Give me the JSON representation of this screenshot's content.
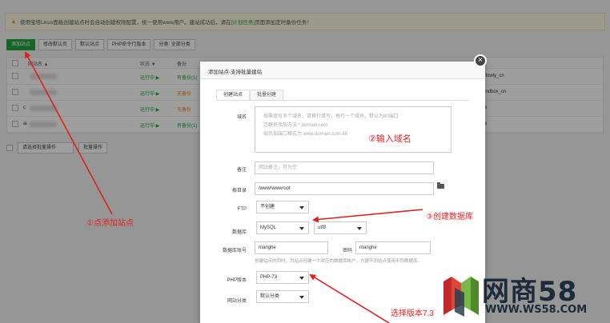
{
  "notice": {
    "text": "使用宝塔Linux面板创建站点时会自动创建权限配置，统一使用www用户。建站成功后，请在",
    "link": "[计划任务]",
    "suffix": "页面添加定时备份任务！"
  },
  "toolbar": {
    "add_site": "添加站点",
    "modify_default_page": "修改默认页",
    "default_site": "默认站点",
    "php_cli_version": "PHP命令行版本",
    "category": "分类: 全部分类"
  },
  "table": {
    "headers": {
      "site_name": "网站名 ▲",
      "status": "状态 ▼",
      "backup": "备份"
    },
    "rows": [
      {
        "prefix": "",
        "status": "运行中 ▶",
        "backup": "有备份(1)",
        "remark": "flowly_cn"
      },
      {
        "prefix": "",
        "status": "运行中 ▶",
        "backup": "无备份",
        "remark": "indbox_cn"
      },
      {
        "prefix": "c",
        "status": "运行中 ▶",
        "backup": "无备份",
        "remark": "e"
      },
      {
        "prefix": "ai",
        "status": "运行中 ▶",
        "backup": "有备份(1)",
        "remark": "e"
      }
    ],
    "batch_select": "请选择批量操作",
    "batch_button": "批量操作"
  },
  "modal": {
    "title": "添加站点-支持批量建站",
    "close": "×",
    "tabs": [
      "创建站点",
      "批量创建"
    ],
    "domain": {
      "label": "域名",
      "placeholder_lines": [
        "如需填写多个域名，请换行填写，每行一个域名，默认为80端口",
        "泛解析添加方法 *.domain.com",
        "如另加端口格式为 www.domain.com:88"
      ]
    },
    "remark": {
      "label": "备注",
      "placeholder": "网站备注，可为空"
    },
    "root": {
      "label": "根目录",
      "value": "/www/wwwroot"
    },
    "ftp": {
      "label": "FTP",
      "value": "不创建"
    },
    "database": {
      "label": "数据库",
      "type": "MySQL",
      "charset": "utf8"
    },
    "db_account": {
      "label": "数据库账号",
      "user": "manghe",
      "password_label": "密码",
      "password": "manghe",
      "hint": "创建站点的同时，为站点创建一个对应的数据库帐户，方便不同站点使用不同数据库。"
    },
    "php": {
      "label": "PHP版本",
      "value": "PHP-73"
    },
    "category": {
      "label": "网站分类",
      "value": "默认分类"
    }
  },
  "annotations": {
    "step1": "①点添加站点",
    "step2": "②输入域名",
    "step3": "③创建数据库",
    "step4": "选择版本7.3"
  },
  "watermark": {
    "brand": "网商58",
    "url": "WWW.WS58.COM"
  },
  "colors": {
    "accent": "#20a53a",
    "annotation": "#e02020",
    "warning": "#f08a24"
  }
}
